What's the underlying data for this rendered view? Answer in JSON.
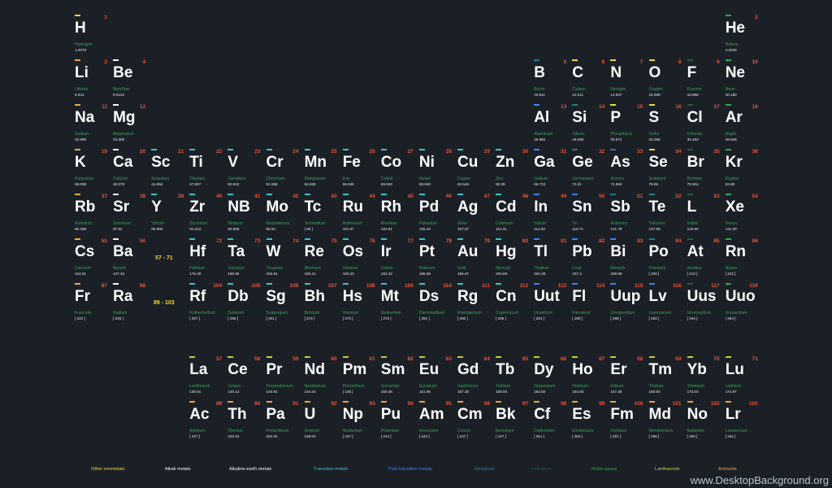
{
  "colors": {
    "nonmetal": "#f0d733",
    "alkali": "#f3a64a",
    "alkaline": "#f5f5f5",
    "transition": "#3ec4c4",
    "post": "#3b82f6",
    "metalloid": "#1f7c92",
    "halogen": "#245a3a",
    "noble": "#2aa84f",
    "lanthanoid": "#c0cf3a",
    "actinoid": "#e8a53a"
  },
  "elements": [
    {
      "n": "1",
      "s": "H",
      "name": "Hydrogen",
      "m": "1.0079",
      "r": 0,
      "c": 0,
      "cat": "nonmetal"
    },
    {
      "n": "2",
      "s": "He",
      "name": "Helium",
      "m": "4.0026",
      "r": 0,
      "c": 17,
      "cat": "noble"
    },
    {
      "n": "3",
      "s": "Li",
      "name": "Lithium",
      "m": "6.941",
      "r": 1,
      "c": 0,
      "cat": "alkali"
    },
    {
      "n": "4",
      "s": "Be",
      "name": "Beryllium",
      "m": "9.0122",
      "r": 1,
      "c": 1,
      "cat": "alkaline"
    },
    {
      "n": "5",
      "s": "B",
      "name": "Boron",
      "m": "10.811",
      "r": 1,
      "c": 12,
      "cat": "metalloid"
    },
    {
      "n": "6",
      "s": "C",
      "name": "Carbon",
      "m": "12.011",
      "r": 1,
      "c": 13,
      "cat": "nonmetal"
    },
    {
      "n": "7",
      "s": "N",
      "name": "Nitrogen",
      "m": "14.007",
      "r": 1,
      "c": 14,
      "cat": "nonmetal"
    },
    {
      "n": "8",
      "s": "O",
      "name": "Oxygen",
      "m": "15.999",
      "r": 1,
      "c": 15,
      "cat": "nonmetal"
    },
    {
      "n": "9",
      "s": "F",
      "name": "Fluorine",
      "m": "18.998",
      "r": 1,
      "c": 16,
      "cat": "halogen"
    },
    {
      "n": "10",
      "s": "Ne",
      "name": "Neon",
      "m": "20.180",
      "r": 1,
      "c": 17,
      "cat": "noble"
    },
    {
      "n": "11",
      "s": "Na",
      "name": "Sodium",
      "m": "22.990",
      "r": 2,
      "c": 0,
      "cat": "alkali"
    },
    {
      "n": "12",
      "s": "Mg",
      "name": "Magnesium",
      "m": "24.305",
      "r": 2,
      "c": 1,
      "cat": "alkaline"
    },
    {
      "n": "13",
      "s": "Al",
      "name": "Aluminium",
      "m": "26.982",
      "r": 2,
      "c": 12,
      "cat": "post"
    },
    {
      "n": "14",
      "s": "Si",
      "name": "Silicon",
      "m": "28.086",
      "r": 2,
      "c": 13,
      "cat": "metalloid"
    },
    {
      "n": "15",
      "s": "P",
      "name": "Phosphorus",
      "m": "30.974",
      "r": 2,
      "c": 14,
      "cat": "nonmetal"
    },
    {
      "n": "16",
      "s": "S",
      "name": "Sulfur",
      "m": "32.065",
      "r": 2,
      "c": 15,
      "cat": "nonmetal"
    },
    {
      "n": "17",
      "s": "Cl",
      "name": "Chlorine",
      "m": "35.453",
      "r": 2,
      "c": 16,
      "cat": "halogen"
    },
    {
      "n": "18",
      "s": "Ar",
      "name": "Argon",
      "m": "39.948",
      "r": 2,
      "c": 17,
      "cat": "noble"
    },
    {
      "n": "19",
      "s": "K",
      "name": "Potassium",
      "m": "39.098",
      "r": 3,
      "c": 0,
      "cat": "alkali"
    },
    {
      "n": "20",
      "s": "Ca",
      "name": "Calcium",
      "m": "40.078",
      "r": 3,
      "c": 1,
      "cat": "alkaline"
    },
    {
      "n": "21",
      "s": "Sc",
      "name": "Scandium",
      "m": "44.956",
      "r": 3,
      "c": 2,
      "cat": "transition"
    },
    {
      "n": "22",
      "s": "Ti",
      "name": "Titanium",
      "m": "47.867",
      "r": 3,
      "c": 3,
      "cat": "transition"
    },
    {
      "n": "23",
      "s": "V",
      "name": "Vanadium",
      "m": "50.942",
      "r": 3,
      "c": 4,
      "cat": "transition"
    },
    {
      "n": "24",
      "s": "Cr",
      "name": "Chromium",
      "m": "51.996",
      "r": 3,
      "c": 5,
      "cat": "transition"
    },
    {
      "n": "25",
      "s": "Mn",
      "name": "Manganese",
      "m": "54.938",
      "r": 3,
      "c": 6,
      "cat": "transition"
    },
    {
      "n": "26",
      "s": "Fe",
      "name": "Iron",
      "m": "55.845",
      "r": 3,
      "c": 7,
      "cat": "transition"
    },
    {
      "n": "27",
      "s": "Co",
      "name": "Cobalt",
      "m": "58.933",
      "r": 3,
      "c": 8,
      "cat": "transition"
    },
    {
      "n": "28",
      "s": "Ni",
      "name": "Nickel",
      "m": "58.693",
      "r": 3,
      "c": 9,
      "cat": "transition"
    },
    {
      "n": "29",
      "s": "Cu",
      "name": "Copper",
      "m": "63.546",
      "r": 3,
      "c": 10,
      "cat": "transition"
    },
    {
      "n": "30",
      "s": "Zn",
      "name": "Zinc",
      "m": "65.39",
      "r": 3,
      "c": 11,
      "cat": "transition"
    },
    {
      "n": "31",
      "s": "Ga",
      "name": "Gallium",
      "m": "69.723",
      "r": 3,
      "c": 12,
      "cat": "post"
    },
    {
      "n": "32",
      "s": "Ge",
      "name": "Germanium",
      "m": "72.61",
      "r": 3,
      "c": 13,
      "cat": "metalloid"
    },
    {
      "n": "33",
      "s": "As",
      "name": "Arsenic",
      "m": "74.992",
      "r": 3,
      "c": 14,
      "cat": "metalloid"
    },
    {
      "n": "34",
      "s": "Se",
      "name": "Selenium",
      "m": "78.96",
      "r": 3,
      "c": 15,
      "cat": "nonmetal"
    },
    {
      "n": "35",
      "s": "Br",
      "name": "Bromine",
      "m": "79.904",
      "r": 3,
      "c": 16,
      "cat": "halogen"
    },
    {
      "n": "36",
      "s": "Kr",
      "name": "Krypton",
      "m": "83.80",
      "r": 3,
      "c": 17,
      "cat": "noble"
    },
    {
      "n": "37",
      "s": "Rb",
      "name": "Rubidium",
      "m": "85.468",
      "r": 4,
      "c": 0,
      "cat": "alkali"
    },
    {
      "n": "38",
      "s": "Sr",
      "name": "Strontium",
      "m": "87.62",
      "r": 4,
      "c": 1,
      "cat": "alkaline"
    },
    {
      "n": "39",
      "s": "Y",
      "name": "Yttrium",
      "m": "88.906",
      "r": 4,
      "c": 2,
      "cat": "transition"
    },
    {
      "n": "40",
      "s": "Zr",
      "name": "Zirconium",
      "m": "91.224",
      "r": 4,
      "c": 3,
      "cat": "transition"
    },
    {
      "n": "41",
      "s": "NB",
      "name": "Niobium",
      "m": "92.906",
      "r": 4,
      "c": 4,
      "cat": "transition"
    },
    {
      "n": "42",
      "s": "Mo",
      "name": "Molybdenum",
      "m": "95.94",
      "r": 4,
      "c": 5,
      "cat": "transition"
    },
    {
      "n": "43",
      "s": "Tc",
      "name": "Technetium",
      "m": "[ 98 ]",
      "r": 4,
      "c": 6,
      "cat": "transition"
    },
    {
      "n": "44",
      "s": "Ru",
      "name": "Ruthenium",
      "m": "101.07",
      "r": 4,
      "c": 7,
      "cat": "transition"
    },
    {
      "n": "45",
      "s": "Rh",
      "name": "Rhodium",
      "m": "102.91",
      "r": 4,
      "c": 8,
      "cat": "transition"
    },
    {
      "n": "46",
      "s": "Pd",
      "name": "Palladium",
      "m": "106.42",
      "r": 4,
      "c": 9,
      "cat": "transition"
    },
    {
      "n": "47",
      "s": "Ag",
      "name": "Silver",
      "m": "107.87",
      "r": 4,
      "c": 10,
      "cat": "transition"
    },
    {
      "n": "48",
      "s": "Cd",
      "name": "Cadmium",
      "m": "112.41",
      "r": 4,
      "c": 11,
      "cat": "transition"
    },
    {
      "n": "49",
      "s": "In",
      "name": "Indium",
      "m": "114.82",
      "r": 4,
      "c": 12,
      "cat": "post"
    },
    {
      "n": "50",
      "s": "Sn",
      "name": "Tin",
      "m": "118.71",
      "r": 4,
      "c": 13,
      "cat": "post"
    },
    {
      "n": "51",
      "s": "Sb",
      "name": "Antimony",
      "m": "121.76",
      "r": 4,
      "c": 14,
      "cat": "metalloid"
    },
    {
      "n": "52",
      "s": "Te",
      "name": "Tellurium",
      "m": "127.60",
      "r": 4,
      "c": 15,
      "cat": "metalloid"
    },
    {
      "n": "53",
      "s": "L",
      "name": "Iodine",
      "m": "126.90",
      "r": 4,
      "c": 16,
      "cat": "halogen"
    },
    {
      "n": "54",
      "s": "Xe",
      "name": "Xenon",
      "m": "131.29",
      "r": 4,
      "c": 17,
      "cat": "noble"
    },
    {
      "n": "55",
      "s": "Cs",
      "name": "Caesium",
      "m": "132.91",
      "r": 5,
      "c": 0,
      "cat": "alkali"
    },
    {
      "n": "56",
      "s": "Ba",
      "name": "Barium",
      "m": "137.33",
      "r": 5,
      "c": 1,
      "cat": "alkaline"
    },
    {
      "n": "72",
      "s": "Hf",
      "name": "Hafnium",
      "m": "178.49",
      "r": 5,
      "c": 3,
      "cat": "transition"
    },
    {
      "n": "73",
      "s": "Ta",
      "name": "Tantalum",
      "m": "180.95",
      "r": 5,
      "c": 4,
      "cat": "transition"
    },
    {
      "n": "74",
      "s": "W",
      "name": "Tungsten",
      "m": "183.84",
      "r": 5,
      "c": 5,
      "cat": "transition"
    },
    {
      "n": "75",
      "s": "Re",
      "name": "Rhenium",
      "m": "186.21",
      "r": 5,
      "c": 6,
      "cat": "transition"
    },
    {
      "n": "76",
      "s": "Os",
      "name": "Osmium",
      "m": "190.23",
      "r": 5,
      "c": 7,
      "cat": "transition"
    },
    {
      "n": "77",
      "s": "Ir",
      "name": "Iridium",
      "m": "192.22",
      "r": 5,
      "c": 8,
      "cat": "transition"
    },
    {
      "n": "78",
      "s": "Pt",
      "name": "Platinum",
      "m": "195.08",
      "r": 5,
      "c": 9,
      "cat": "transition"
    },
    {
      "n": "79",
      "s": "Au",
      "name": "Gold",
      "m": "196.97",
      "r": 5,
      "c": 10,
      "cat": "transition"
    },
    {
      "n": "80",
      "s": "Hg",
      "name": "Mercury",
      "m": "200.59",
      "r": 5,
      "c": 11,
      "cat": "transition"
    },
    {
      "n": "81",
      "s": "Tl",
      "name": "Thallium",
      "m": "204.38",
      "r": 5,
      "c": 12,
      "cat": "post"
    },
    {
      "n": "82",
      "s": "Pb",
      "name": "Lead",
      "m": "207.2",
      "r": 5,
      "c": 13,
      "cat": "post"
    },
    {
      "n": "83",
      "s": "Bi",
      "name": "Bismuth",
      "m": "208.98",
      "r": 5,
      "c": 14,
      "cat": "post"
    },
    {
      "n": "84",
      "s": "Po",
      "name": "Polonium",
      "m": "[ 209 ]",
      "r": 5,
      "c": 15,
      "cat": "metalloid"
    },
    {
      "n": "85",
      "s": "At",
      "name": "Astatine",
      "m": "[ 210 ]",
      "r": 5,
      "c": 16,
      "cat": "halogen"
    },
    {
      "n": "86",
      "s": "Rn",
      "name": "Radon",
      "m": "[ 222 ]",
      "r": 5,
      "c": 17,
      "cat": "noble"
    },
    {
      "n": "87",
      "s": "Fr",
      "name": "Francium",
      "m": "[ 223 ]",
      "r": 6,
      "c": 0,
      "cat": "alkali"
    },
    {
      "n": "88",
      "s": "Ra",
      "name": "Radium",
      "m": "[ 226 ]",
      "r": 6,
      "c": 1,
      "cat": "alkaline"
    },
    {
      "n": "104",
      "s": "Rf",
      "name": "Rutherfordium",
      "m": "[ 267 ]",
      "r": 6,
      "c": 3,
      "cat": "transition"
    },
    {
      "n": "105",
      "s": "Db",
      "name": "Dubnium",
      "m": "[ 268 ]",
      "r": 6,
      "c": 4,
      "cat": "transition"
    },
    {
      "n": "106",
      "s": "Sg",
      "name": "Seaborgium",
      "m": "[ 261 ]",
      "r": 6,
      "c": 5,
      "cat": "transition"
    },
    {
      "n": "107",
      "s": "Bh",
      "name": "Bohrium",
      "m": "[ 272 ]",
      "r": 6,
      "c": 6,
      "cat": "transition"
    },
    {
      "n": "108",
      "s": "Hs",
      "name": "Hassium",
      "m": "[ 270 ]",
      "r": 6,
      "c": 7,
      "cat": "transition"
    },
    {
      "n": "109",
      "s": "Mt",
      "name": "Meitnerium",
      "m": "[ 276 ]",
      "r": 6,
      "c": 8,
      "cat": "transition"
    },
    {
      "n": "110",
      "s": "Ds",
      "name": "Darmstadtium",
      "m": "[ 281 ]",
      "r": 6,
      "c": 9,
      "cat": "transition"
    },
    {
      "n": "111",
      "s": "Rg",
      "name": "Roentgenium",
      "m": "[ 280 ]",
      "r": 6,
      "c": 10,
      "cat": "transition"
    },
    {
      "n": "112",
      "s": "Cn",
      "name": "Copernicium",
      "m": "[ 285 ]",
      "r": 6,
      "c": 11,
      "cat": "transition"
    },
    {
      "n": "113",
      "s": "Uut",
      "name": "Ununtrium",
      "m": "[ 284 ]",
      "r": 6,
      "c": 12,
      "cat": "post"
    },
    {
      "n": "114",
      "s": "Fl",
      "name": "Flerovium",
      "m": "[ 289 ]",
      "r": 6,
      "c": 13,
      "cat": "post"
    },
    {
      "n": "115",
      "s": "Uup",
      "name": "Ununpentium",
      "m": "[ 288 ]",
      "r": 6,
      "c": 14,
      "cat": "post"
    },
    {
      "n": "116",
      "s": "Lv",
      "name": "Livermorium",
      "m": "[ 293 ]",
      "r": 6,
      "c": 15,
      "cat": "post"
    },
    {
      "n": "117",
      "s": "Uus",
      "name": "Ununseptium",
      "m": "[ 294 ]",
      "r": 6,
      "c": 16,
      "cat": "halogen"
    },
    {
      "n": "118",
      "s": "Uuo",
      "name": "Ununoctium",
      "m": "[ 294 ]",
      "r": 6,
      "c": 17,
      "cat": "noble"
    },
    {
      "n": "57",
      "s": "La",
      "name": "Lanthanum",
      "m": "138.91",
      "r": 8,
      "c": 3,
      "cat": "lanthanoid"
    },
    {
      "n": "58",
      "s": "Ce",
      "name": "Cerium",
      "m": "140.12",
      "r": 8,
      "c": 4,
      "cat": "lanthanoid"
    },
    {
      "n": "59",
      "s": "Pr",
      "name": "Praseodymium",
      "m": "140.91",
      "r": 8,
      "c": 5,
      "cat": "lanthanoid"
    },
    {
      "n": "60",
      "s": "Nd",
      "name": "Neodymium",
      "m": "144.24",
      "r": 8,
      "c": 6,
      "cat": "lanthanoid"
    },
    {
      "n": "61",
      "s": "Pm",
      "name": "Promethium",
      "m": "[ 145 ]",
      "r": 8,
      "c": 7,
      "cat": "lanthanoid"
    },
    {
      "n": "62",
      "s": "Sm",
      "name": "Samarium",
      "m": "150.36",
      "r": 8,
      "c": 8,
      "cat": "lanthanoid"
    },
    {
      "n": "63",
      "s": "Eu",
      "name": "Europium",
      "m": "151.96",
      "r": 8,
      "c": 9,
      "cat": "lanthanoid"
    },
    {
      "n": "64",
      "s": "Gd",
      "name": "Gadolinium",
      "m": "157.25",
      "r": 8,
      "c": 10,
      "cat": "lanthanoid"
    },
    {
      "n": "65",
      "s": "Tb",
      "name": "Terbium",
      "m": "158.93",
      "r": 8,
      "c": 11,
      "cat": "lanthanoid"
    },
    {
      "n": "66",
      "s": "Dy",
      "name": "Dysprosium",
      "m": "162.50",
      "r": 8,
      "c": 12,
      "cat": "lanthanoid"
    },
    {
      "n": "67",
      "s": "Ho",
      "name": "Holmium",
      "m": "164.93",
      "r": 8,
      "c": 13,
      "cat": "lanthanoid"
    },
    {
      "n": "68",
      "s": "Er",
      "name": "Erbium",
      "m": "167.26",
      "r": 8,
      "c": 14,
      "cat": "lanthanoid"
    },
    {
      "n": "69",
      "s": "Tm",
      "name": "Thulium",
      "m": "168.93",
      "r": 8,
      "c": 15,
      "cat": "lanthanoid"
    },
    {
      "n": "70",
      "s": "Yb",
      "name": "Ytterbium",
      "m": "173.04",
      "r": 8,
      "c": 16,
      "cat": "lanthanoid"
    },
    {
      "n": "71",
      "s": "Lu",
      "name": "Lutetium",
      "m": "174.97",
      "r": 8,
      "c": 17,
      "cat": "lanthanoid"
    },
    {
      "n": "89",
      "s": "Ac",
      "name": "Actinium",
      "m": "[ 227 ]",
      "r": 9,
      "c": 3,
      "cat": "actinoid"
    },
    {
      "n": "90",
      "s": "Th",
      "name": "Thorium",
      "m": "232.04",
      "r": 9,
      "c": 4,
      "cat": "actinoid"
    },
    {
      "n": "91",
      "s": "Pa",
      "name": "Protactinium",
      "m": "231.04",
      "r": 9,
      "c": 5,
      "cat": "actinoid"
    },
    {
      "n": "92",
      "s": "U",
      "name": "Uranium",
      "m": "238.03",
      "r": 9,
      "c": 6,
      "cat": "actinoid"
    },
    {
      "n": "93",
      "s": "Np",
      "name": "Neptunium",
      "m": "[ 237 ]",
      "r": 9,
      "c": 7,
      "cat": "actinoid"
    },
    {
      "n": "94",
      "s": "Pu",
      "name": "Plutonium",
      "m": "[ 244 ]",
      "r": 9,
      "c": 8,
      "cat": "actinoid"
    },
    {
      "n": "95",
      "s": "Am",
      "name": "Americium",
      "m": "[ 243 ]",
      "r": 9,
      "c": 9,
      "cat": "actinoid"
    },
    {
      "n": "96",
      "s": "Cm",
      "name": "Curium",
      "m": "[ 247 ]",
      "r": 9,
      "c": 10,
      "cat": "actinoid"
    },
    {
      "n": "97",
      "s": "Bk",
      "name": "Berkelium",
      "m": "[ 247 ]",
      "r": 9,
      "c": 11,
      "cat": "actinoid"
    },
    {
      "n": "98",
      "s": "Cf",
      "name": "Californium",
      "m": "[ 251 ]",
      "r": 9,
      "c": 12,
      "cat": "actinoid"
    },
    {
      "n": "99",
      "s": "Es",
      "name": "Einsteinium",
      "m": "[ 252 ]",
      "r": 9,
      "c": 13,
      "cat": "actinoid"
    },
    {
      "n": "100",
      "s": "Fm",
      "name": "Fermium",
      "m": "[ 257 ]",
      "r": 9,
      "c": 14,
      "cat": "actinoid"
    },
    {
      "n": "101",
      "s": "Md",
      "name": "Mendelevium",
      "m": "[ 258 ]",
      "r": 9,
      "c": 15,
      "cat": "actinoid"
    },
    {
      "n": "102",
      "s": "No",
      "name": "Nobelium",
      "m": "[ 259 ]",
      "r": 9,
      "c": 16,
      "cat": "actinoid"
    },
    {
      "n": "103",
      "s": "Lr",
      "name": "Lawrencium",
      "m": "[ 262 ]",
      "r": 9,
      "c": 17,
      "cat": "actinoid"
    }
  ],
  "ranges": {
    "lanthanide_range": "57 - 71",
    "actinide_range": "89 - 103"
  },
  "legend": [
    {
      "label": "Other nonmetals",
      "cat": "nonmetal"
    },
    {
      "label": "Alkali metals",
      "cat": "alkaline"
    },
    {
      "label": "Alkaline-earth metals",
      "cat": "alkaline"
    },
    {
      "label": "Transition metals",
      "cat": "transition"
    },
    {
      "label": "Post-transition metals",
      "cat": "post"
    },
    {
      "label": "Metalloids",
      "cat": "metalloid"
    },
    {
      "label": "Halogens",
      "cat": "halogen"
    },
    {
      "label": "Noble gases",
      "cat": "noble"
    },
    {
      "label": "Lanthanoids",
      "cat": "lanthanoid"
    },
    {
      "label": "Actinoids",
      "cat": "actinoid"
    }
  ],
  "watermark": "www.DesktopBackground.org"
}
